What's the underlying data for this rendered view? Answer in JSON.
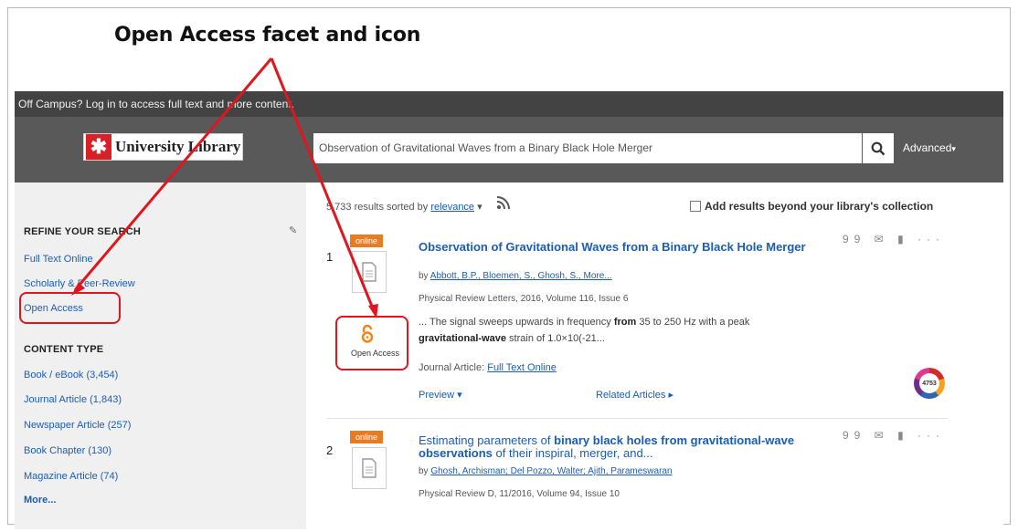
{
  "annotation": {
    "caption": "Open Access facet and icon",
    "color": "#e0161e"
  },
  "offcampus": {
    "text": "Off Campus? Log in to access full text and more content."
  },
  "header": {
    "logo_mark": "✱",
    "logo_text": "University Library",
    "search_value": "Observation of Gravitational Waves from a Binary Black Hole Merger",
    "search_icon": "search-icon",
    "advanced_label": "Advanced",
    "advanced_caret": "▾"
  },
  "sidebar": {
    "refine_title": "REFINE YOUR SEARCH",
    "edit_icon": "✎",
    "facets": [
      "Full Text Online",
      "Scholarly & Peer-Review",
      "Open Access"
    ],
    "content_type_title": "CONTENT TYPE",
    "content_types": [
      "Book / eBook (3,454)",
      "Journal Article (1,843)",
      "Newspaper Article (257)",
      "Book Chapter (130)",
      "Magazine Article (74)"
    ],
    "more_label": "More..."
  },
  "results": {
    "count_text": "5,733 results sorted by",
    "sort_label": "relevance",
    "sort_caret": "▾",
    "rss_icon": "rss-icon",
    "beyond_label": "Add results beyond your library's collection",
    "items": [
      {
        "num": "1",
        "badge": "online",
        "title": "Observation of Gravitational Waves from a Binary Black Hole Merger",
        "authors_prefix": "by",
        "authors": "Abbott, B.P., Bloemen, S., Ghosh, S., More...",
        "meta": "Physical Review Letters, 2016, Volume 116, Issue 6",
        "snippet_1_a": "... The signal sweeps upwards in frequency",
        "snippet_1_b": "from",
        "snippet_1_c": "35 to 250 Hz with a peak",
        "snippet_2_b": "gravitational-wave",
        "snippet_2_c": "strain of 1.0×10(-21...",
        "oa_label": "Open Access",
        "jtype_prefix": "Journal Article:",
        "jtype_link": "Full Text Online",
        "preview": "Preview ▾",
        "related": "Related Articles ▸",
        "altmetric": "4753"
      },
      {
        "num": "2",
        "badge": "online",
        "title_a": "Estimating parameters of",
        "title_b": "binary black holes from gravitational-wave observations",
        "title_c": "of their inspiral, merger, and...",
        "authors_prefix": "by",
        "authors": "Ghosh, Archisman; Del Pozzo, Walter; Ajith, Parameswaran",
        "meta": "Physical Review D, 11/2016, Volume 94, Issue 10"
      }
    ],
    "action_icons": "99 ✉ ▮ ···"
  }
}
